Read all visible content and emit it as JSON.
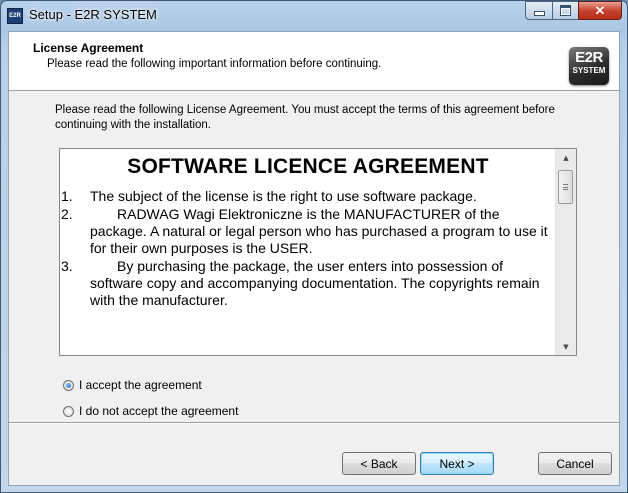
{
  "window": {
    "title": "Setup - E2R SYSTEM",
    "app_icon_text": "E2R",
    "caption_buttons": {
      "minimize": "minimize-icon",
      "maximize": "maximize-icon",
      "close": "close-icon"
    }
  },
  "header": {
    "title": "License Agreement",
    "subtitle": "Please read the following important information before continuing.",
    "logo_line1": "E2R",
    "logo_line2": "SYSTEM"
  },
  "intro_text": "Please read the following License Agreement. You must accept the terms of this agreement before continuing with the installation.",
  "license": {
    "heading": "SOFTWARE LICENCE AGREEMENT",
    "clauses": [
      {
        "num": "1.",
        "text": "The subject of the license is the right to use software package."
      },
      {
        "num": "2.",
        "text": "RADWAG Wagi Elektroniczne is the MANUFACTURER of the package. A natural or legal person who has purchased a program to use it for their own purposes is the USER."
      },
      {
        "num": "3.",
        "text": "By purchasing the package, the user enters into possession of software copy and accompanying documentation. The copyrights remain with the manufacturer."
      }
    ],
    "scroll_fraction": 0.0
  },
  "radio": {
    "accept_label": "I accept the agreement",
    "decline_label": "I do not accept the agreement",
    "selected": "accept"
  },
  "buttons": {
    "back": "< Back",
    "next": "Next >",
    "cancel": "Cancel"
  },
  "colors": {
    "title_bar": "#a9c6e3",
    "close_button": "#c7442f",
    "default_button_border": "#3c7fb1"
  }
}
